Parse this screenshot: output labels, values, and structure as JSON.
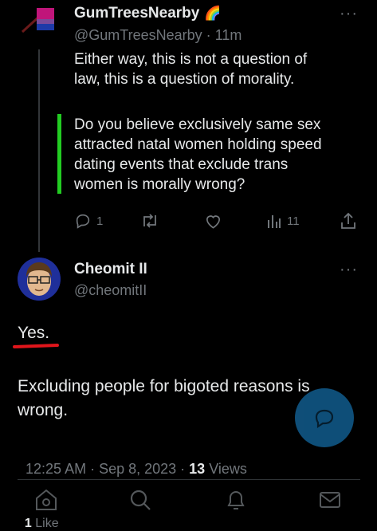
{
  "parent_tweet": {
    "display_name": "GumTreesNearby",
    "name_emoji": "🌈",
    "handle": "@GumTreesNearby",
    "separator": "·",
    "time": "11m",
    "line1": "Either way, this is not a question of",
    "line2": "law, this is a question of morality.",
    "quote_lines": [
      "Do you believe exclusively same sex",
      "attracted natal women holding speed",
      "dating events that exclude trans",
      "women is morally wrong?"
    ],
    "quote_bar_color": "#22cc22",
    "actions": {
      "replies": "1",
      "retweets": "",
      "likes": "",
      "views": "11"
    }
  },
  "main_tweet": {
    "display_name": "Cheomit II",
    "handle": "@cheomitII",
    "text_1": "Yes.",
    "underline_color": "#e0151b",
    "text_2_line1": "Excluding people for bigoted reasons is",
    "text_2_line2": "wrong.",
    "timestamp": "12:25 AM · Sep 8, 2023 · ",
    "views_count": "13",
    "views_label": " Views",
    "likes_count": "1",
    "likes_label": " Like"
  },
  "bottom_nav": [
    "home-icon",
    "search-icon",
    "bell-icon",
    "mail-icon"
  ],
  "fab": {
    "icon": "compose-reply-icon",
    "color": "#1d9bf0"
  },
  "more_glyph": "···"
}
